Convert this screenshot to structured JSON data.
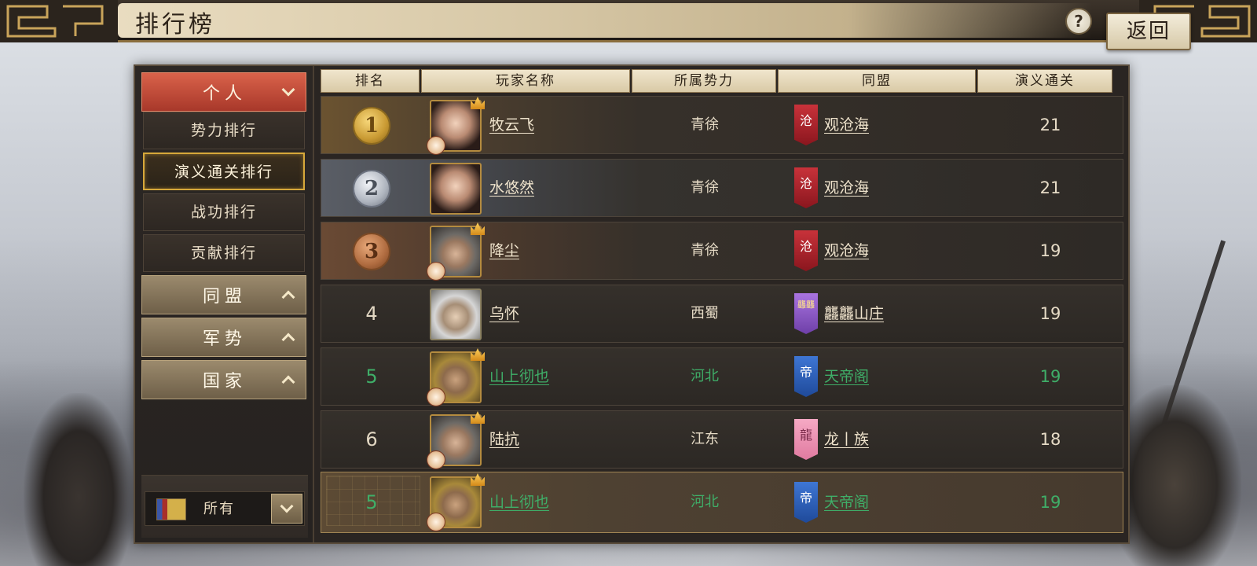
{
  "header": {
    "title": "排行榜",
    "help_label": "?",
    "back_label": "返回"
  },
  "sidebar": {
    "active_category": {
      "label": "个人",
      "icon": "chevron-down-icon"
    },
    "sub_items": [
      {
        "label": "势力排行",
        "selected": false
      },
      {
        "label": "演义通关排行",
        "selected": true
      },
      {
        "label": "战功排行",
        "selected": false
      },
      {
        "label": "贡献排行",
        "selected": false
      }
    ],
    "collapsed_categories": [
      {
        "label": "同盟",
        "icon": "chevron-up-icon"
      },
      {
        "label": "军势",
        "icon": "chevron-up-icon"
      },
      {
        "label": "国家",
        "icon": "chevron-up-icon"
      }
    ],
    "filter": {
      "label": "所有",
      "icon": "flag-icon",
      "dropdown_icon": "chevron-down-icon"
    }
  },
  "table": {
    "headers": [
      "排名",
      "玩家名称",
      "所属势力",
      "同盟",
      "演义通关"
    ],
    "rows": [
      {
        "rank": "1",
        "rank_style": "gold-medal",
        "name": "牧云飞",
        "faction": "青徐",
        "alliance_flag": "沧",
        "alliance_flag_color": "#b0262e",
        "alliance": "观沧海",
        "stage": "21"
      },
      {
        "rank": "2",
        "rank_style": "silver-medal",
        "name": "水悠然",
        "faction": "青徐",
        "alliance_flag": "沧",
        "alliance_flag_color": "#b0262e",
        "alliance": "观沧海",
        "stage": "21"
      },
      {
        "rank": "3",
        "rank_style": "bronze-medal",
        "name": "降尘",
        "faction": "青徐",
        "alliance_flag": "沧",
        "alliance_flag_color": "#b0262e",
        "alliance": "观沧海",
        "stage": "19"
      },
      {
        "rank": "4",
        "rank_style": "plain",
        "name": "乌怀",
        "faction": "西蜀",
        "alliance_flag": "龘龘",
        "alliance_flag_color": "#8b55c6",
        "alliance": "龘龘山庄",
        "stage": "19"
      },
      {
        "rank": "5",
        "rank_style": "plain-green",
        "name": "山上彻也",
        "faction": "河北",
        "alliance_flag": "帝",
        "alliance_flag_color": "#2f5fb8",
        "alliance": "天帝阁",
        "stage": "19"
      },
      {
        "rank": "6",
        "rank_style": "plain",
        "name": "陆抗",
        "faction": "江东",
        "alliance_flag": "龍",
        "alliance_flag_color": "#ee8fb2",
        "alliance": "龙丨族",
        "stage": "18"
      }
    ],
    "my_row": {
      "rank": "5",
      "name": "山上彻也",
      "faction": "河北",
      "alliance_flag": "帝",
      "alliance_flag_color": "#2f5fb8",
      "alliance": "天帝阁",
      "stage": "19"
    }
  },
  "colors": {
    "highlight_green": "#3fae68",
    "selected_border": "#d7a83a",
    "active_tab_red": "#c04a36"
  }
}
